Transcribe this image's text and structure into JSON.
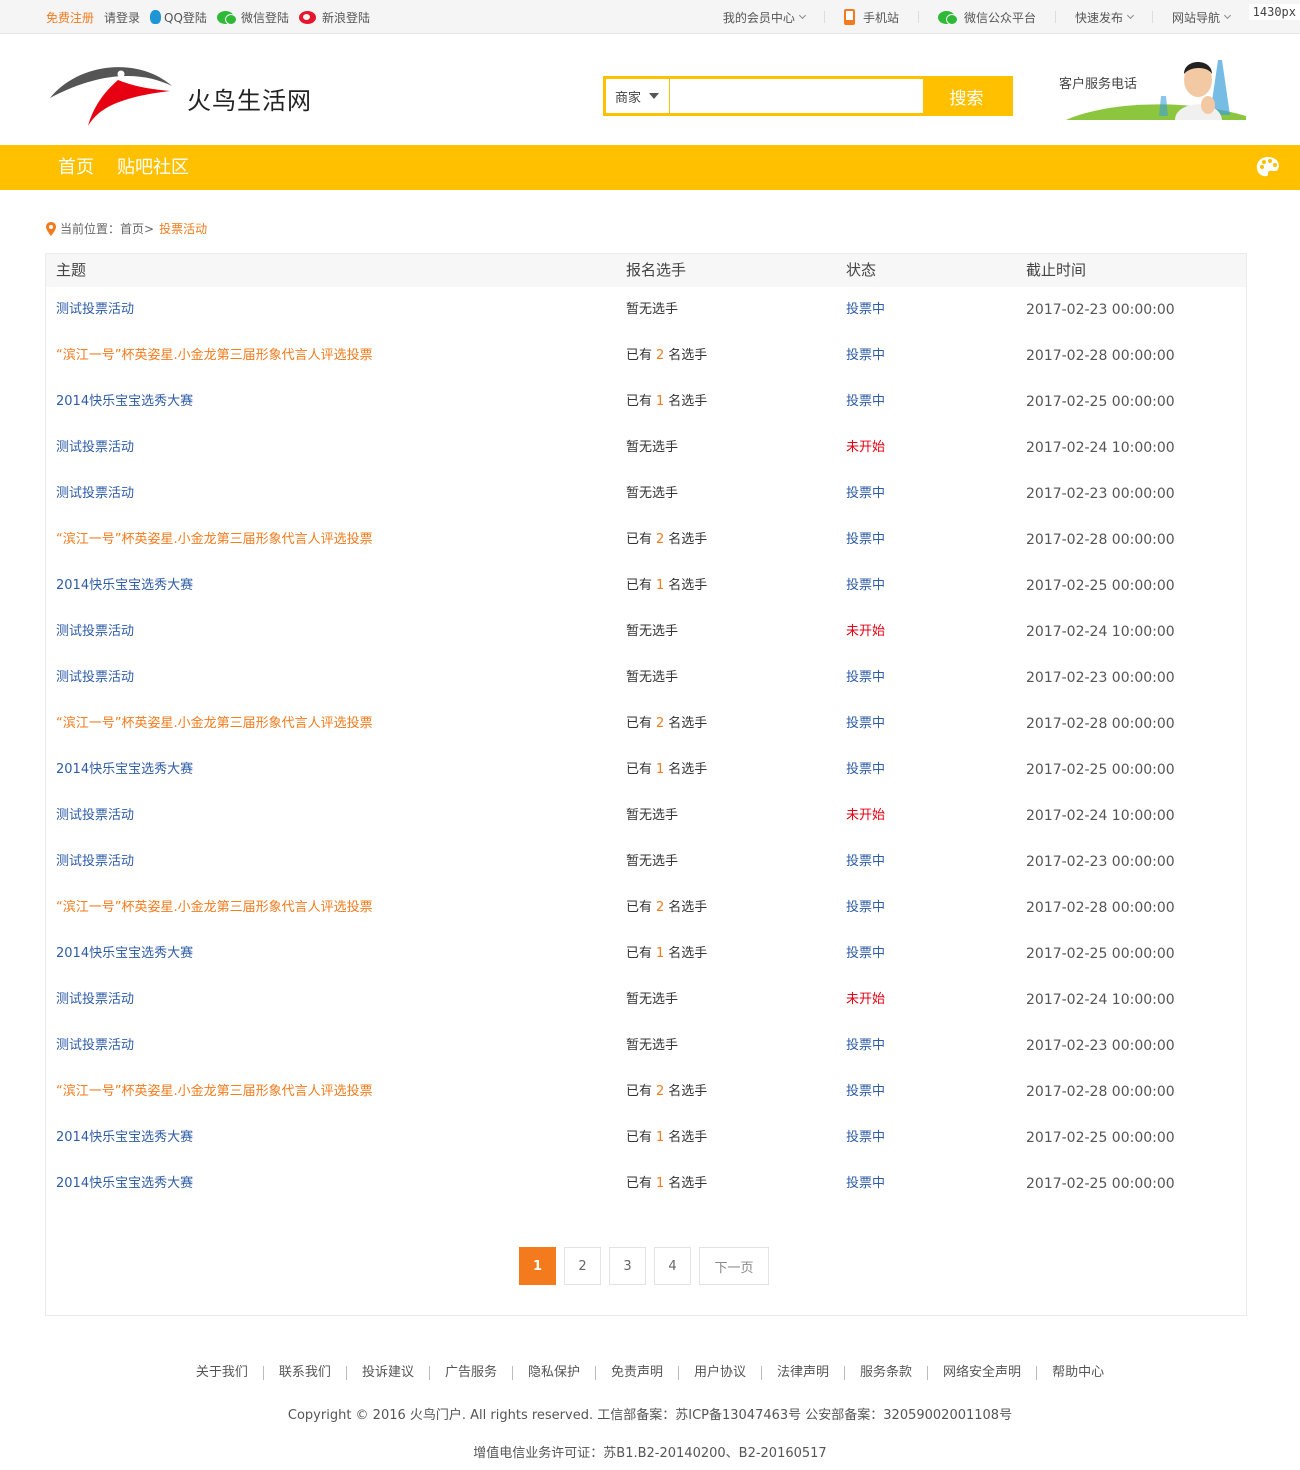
{
  "topbar": {
    "register": "免费注册",
    "login": "请登录",
    "qq_login": "QQ登陆",
    "wechat_login": "微信登陆",
    "weibo_login": "新浪登陆",
    "member_center": "我的会员中心",
    "mobile_site": "手机站",
    "wechat_platform": "微信公众平台",
    "quick_post": "快速发布",
    "site_nav": "网站导航",
    "width_tag": "1430px"
  },
  "header": {
    "site_name": "火鸟生活网",
    "search_scope": "商家",
    "search_placeholder": "",
    "search_button": "搜索",
    "service_label": "客户服务电话"
  },
  "nav": {
    "items": [
      "首页",
      "贴吧社区"
    ]
  },
  "breadcrumb": {
    "prefix": "当前位置：",
    "home": "首页",
    "separator": ">",
    "current": "投票活动"
  },
  "table": {
    "headers": [
      "主题",
      "报名选手",
      "状态",
      "截止时间"
    ],
    "rows": [
      {
        "title": "测试投票活动",
        "title_color": "blue",
        "entrants_prefix": "暂无选手",
        "entrants_count": "",
        "entrants_suffix": "",
        "status": "投票中",
        "status_type": "on",
        "deadline": "2017-02-23 00:00:00"
      },
      {
        "title": "“滨江一号”杯英姿星.小金龙第三届形象代言人评选投票",
        "title_color": "orange",
        "entrants_prefix": "已有",
        "entrants_count": "2",
        "entrants_suffix": "名选手",
        "status": "投票中",
        "status_type": "on",
        "deadline": "2017-02-28 00:00:00"
      },
      {
        "title": "2014快乐宝宝选秀大赛",
        "title_color": "blue",
        "entrants_prefix": "已有",
        "entrants_count": "1",
        "entrants_suffix": "名选手",
        "status": "投票中",
        "status_type": "on",
        "deadline": "2017-02-25 00:00:00"
      },
      {
        "title": "测试投票活动",
        "title_color": "blue",
        "entrants_prefix": "暂无选手",
        "entrants_count": "",
        "entrants_suffix": "",
        "status": "未开始",
        "status_type": "off",
        "deadline": "2017-02-24 10:00:00"
      },
      {
        "title": "测试投票活动",
        "title_color": "blue",
        "entrants_prefix": "暂无选手",
        "entrants_count": "",
        "entrants_suffix": "",
        "status": "投票中",
        "status_type": "on",
        "deadline": "2017-02-23 00:00:00"
      },
      {
        "title": "“滨江一号”杯英姿星.小金龙第三届形象代言人评选投票",
        "title_color": "orange",
        "entrants_prefix": "已有",
        "entrants_count": "2",
        "entrants_suffix": "名选手",
        "status": "投票中",
        "status_type": "on",
        "deadline": "2017-02-28 00:00:00"
      },
      {
        "title": "2014快乐宝宝选秀大赛",
        "title_color": "blue",
        "entrants_prefix": "已有",
        "entrants_count": "1",
        "entrants_suffix": "名选手",
        "status": "投票中",
        "status_type": "on",
        "deadline": "2017-02-25 00:00:00"
      },
      {
        "title": "测试投票活动",
        "title_color": "blue",
        "entrants_prefix": "暂无选手",
        "entrants_count": "",
        "entrants_suffix": "",
        "status": "未开始",
        "status_type": "off",
        "deadline": "2017-02-24 10:00:00"
      },
      {
        "title": "测试投票活动",
        "title_color": "blue",
        "entrants_prefix": "暂无选手",
        "entrants_count": "",
        "entrants_suffix": "",
        "status": "投票中",
        "status_type": "on",
        "deadline": "2017-02-23 00:00:00"
      },
      {
        "title": "“滨江一号”杯英姿星.小金龙第三届形象代言人评选投票",
        "title_color": "orange",
        "entrants_prefix": "已有",
        "entrants_count": "2",
        "entrants_suffix": "名选手",
        "status": "投票中",
        "status_type": "on",
        "deadline": "2017-02-28 00:00:00"
      },
      {
        "title": "2014快乐宝宝选秀大赛",
        "title_color": "blue",
        "entrants_prefix": "已有",
        "entrants_count": "1",
        "entrants_suffix": "名选手",
        "status": "投票中",
        "status_type": "on",
        "deadline": "2017-02-25 00:00:00"
      },
      {
        "title": "测试投票活动",
        "title_color": "blue",
        "entrants_prefix": "暂无选手",
        "entrants_count": "",
        "entrants_suffix": "",
        "status": "未开始",
        "status_type": "off",
        "deadline": "2017-02-24 10:00:00"
      },
      {
        "title": "测试投票活动",
        "title_color": "blue",
        "entrants_prefix": "暂无选手",
        "entrants_count": "",
        "entrants_suffix": "",
        "status": "投票中",
        "status_type": "on",
        "deadline": "2017-02-23 00:00:00"
      },
      {
        "title": "“滨江一号”杯英姿星.小金龙第三届形象代言人评选投票",
        "title_color": "orange",
        "entrants_prefix": "已有",
        "entrants_count": "2",
        "entrants_suffix": "名选手",
        "status": "投票中",
        "status_type": "on",
        "deadline": "2017-02-28 00:00:00"
      },
      {
        "title": "2014快乐宝宝选秀大赛",
        "title_color": "blue",
        "entrants_prefix": "已有",
        "entrants_count": "1",
        "entrants_suffix": "名选手",
        "status": "投票中",
        "status_type": "on",
        "deadline": "2017-02-25 00:00:00"
      },
      {
        "title": "测试投票活动",
        "title_color": "blue",
        "entrants_prefix": "暂无选手",
        "entrants_count": "",
        "entrants_suffix": "",
        "status": "未开始",
        "status_type": "off",
        "deadline": "2017-02-24 10:00:00"
      },
      {
        "title": "测试投票活动",
        "title_color": "blue",
        "entrants_prefix": "暂无选手",
        "entrants_count": "",
        "entrants_suffix": "",
        "status": "投票中",
        "status_type": "on",
        "deadline": "2017-02-23 00:00:00"
      },
      {
        "title": "“滨江一号”杯英姿星.小金龙第三届形象代言人评选投票",
        "title_color": "orange",
        "entrants_prefix": "已有",
        "entrants_count": "2",
        "entrants_suffix": "名选手",
        "status": "投票中",
        "status_type": "on",
        "deadline": "2017-02-28 00:00:00"
      },
      {
        "title": "2014快乐宝宝选秀大赛",
        "title_color": "blue",
        "entrants_prefix": "已有",
        "entrants_count": "1",
        "entrants_suffix": "名选手",
        "status": "投票中",
        "status_type": "on",
        "deadline": "2017-02-25 00:00:00"
      },
      {
        "title": "2014快乐宝宝选秀大赛",
        "title_color": "blue",
        "entrants_prefix": "已有",
        "entrants_count": "1",
        "entrants_suffix": "名选手",
        "status": "投票中",
        "status_type": "on",
        "deadline": "2017-02-25 00:00:00"
      }
    ]
  },
  "pagination": {
    "pages": [
      "1",
      "2",
      "3",
      "4"
    ],
    "current": "1",
    "next": "下一页"
  },
  "footer": {
    "links": [
      "关于我们",
      "联系我们",
      "投诉建议",
      "广告服务",
      "隐私保护",
      "免责声明",
      "用户协议",
      "法律声明",
      "服务条款",
      "网络安全声明",
      "帮助中心"
    ],
    "copyright": "Copyright © 2016 火鸟门户. All rights reserved. 工信部备案：苏ICP备13047463号 公安部备案：32059002001108号",
    "license": "增值电信业务许可证：苏B1.B2-20140200、B2-20160517"
  },
  "colors": {
    "brand_yellow": "#ffc000",
    "accent_orange": "#f37b1d",
    "link_blue": "#2e5ca8",
    "status_red": "#e60012"
  }
}
